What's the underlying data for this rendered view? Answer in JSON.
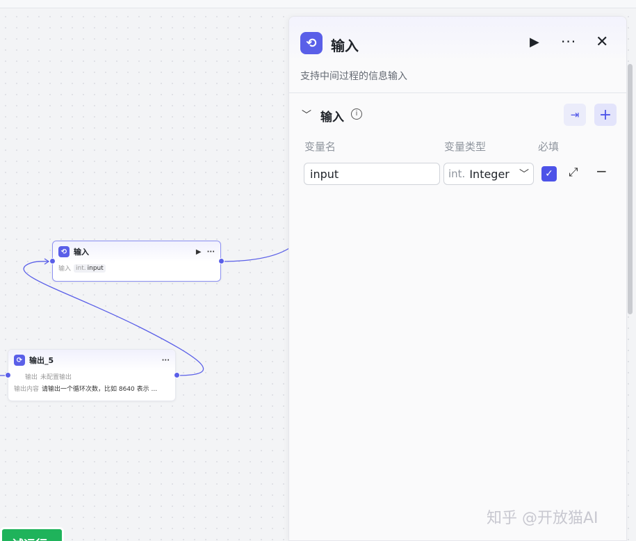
{
  "canvas": {
    "input_node": {
      "title": "输入",
      "run_icon": "▶",
      "more_icon": "···",
      "row_key": "输入",
      "tag_type": "int.",
      "tag_name": "input"
    },
    "output_node": {
      "title": "输出_5",
      "more_icon": "···",
      "row1_key": "输出",
      "row1_value": "未配置输出",
      "row2_key": "输出内容",
      "row2_value": "请输出一个循环次数，比如 8640 表示 ..."
    },
    "run_button": "试运行"
  },
  "panel": {
    "title": "输入",
    "description": "支持中间过程的信息输入",
    "section_title": "输入",
    "columns": [
      "变量名",
      "变量类型",
      "必填"
    ],
    "row": {
      "name": "input",
      "type_prefix": "int.",
      "type": "Integer",
      "required": true
    }
  },
  "colors": {
    "accent": "#4d53e8",
    "node_icon": "#5a5fe8",
    "run_green": "#1fb35b"
  },
  "watermark": "知乎 @开放猫AI"
}
